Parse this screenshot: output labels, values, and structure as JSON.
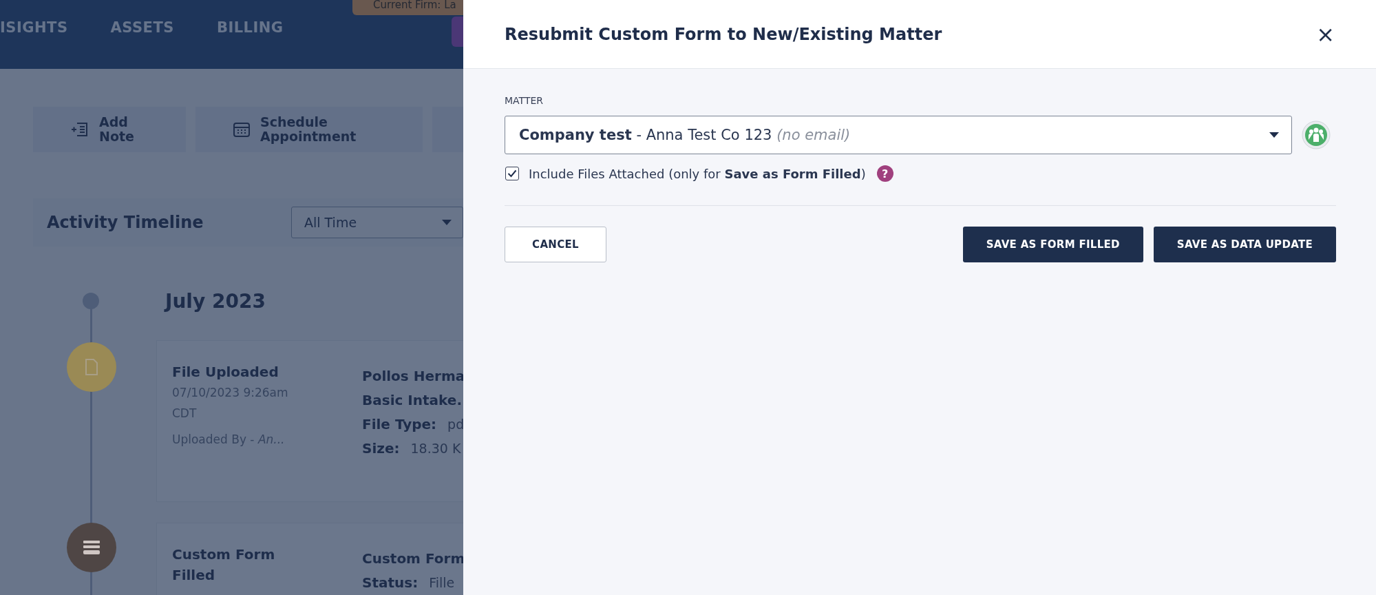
{
  "background": {
    "nav": [
      {
        "label": "ISIGHTS"
      },
      {
        "label": "ASSETS"
      },
      {
        "label": "BILLING"
      }
    ],
    "firm_badge": "Current Firm: La",
    "actions": [
      {
        "label": "Add Note",
        "kind": "note"
      },
      {
        "label": "Schedule Appointment",
        "kind": "calendar"
      },
      {
        "kind": "blank"
      }
    ],
    "timeline": {
      "title": "Activity Timeline",
      "filter": "All Time",
      "month": "July 2023",
      "events": [
        {
          "kind": "file",
          "color": "#9a8a55",
          "title": "File Uploaded",
          "date": "07/10/2023 9:26am",
          "zone": "CDT",
          "by_label": "Uploaded By - ",
          "by": "An...",
          "details": [
            {
              "text": "Pollos Herma"
            },
            {
              "text": "Basic Intake."
            },
            {
              "label": "File Type:",
              "value": "pd"
            },
            {
              "label": "Size:",
              "value": "18.30 K"
            }
          ]
        },
        {
          "kind": "form",
          "color": "#4f4645",
          "title": "Custom Form Filled",
          "details": [
            {
              "text": "Custom Form"
            },
            {
              "label": "Status:",
              "value": "Fille"
            }
          ]
        }
      ]
    }
  },
  "dialog": {
    "title": "Resubmit Custom Form to New/Existing Matter",
    "close": "×",
    "matter_label": "MATTER",
    "matter": {
      "name": "Company test",
      "detail": " - Anna Test Co 123 ",
      "note": "(no email)"
    },
    "include_files": {
      "label": "Include Files Attached (only for **Save as Form Filled**)",
      "checked": true
    },
    "help": "?",
    "buttons": [
      {
        "label": "CANCEL",
        "kind": "secondary"
      },
      {
        "label": "SAVE AS FORM FILLED",
        "kind": "primary"
      },
      {
        "label": "SAVE AS DATA UPDATE",
        "kind": "primary"
      }
    ]
  }
}
